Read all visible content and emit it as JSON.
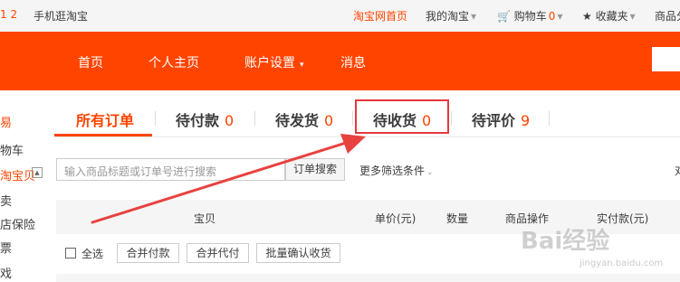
{
  "topbar": {
    "badge": "1 2",
    "mobile_link": "手机逛淘宝",
    "home_link": "淘宝网首页",
    "my_taobao": "我的淘宝",
    "cart_label": "购物车",
    "cart_count": "0",
    "favorites": "收藏夹",
    "goods_category": "商品分"
  },
  "nav": {
    "home": "首页",
    "profile": "个人主页",
    "account_settings": "账户设置",
    "messages": "消息"
  },
  "sidebar": {
    "items": [
      "易",
      "物车",
      "淘宝贝",
      "卖",
      "店保险",
      "票",
      "戏"
    ]
  },
  "tabs": [
    {
      "label": "所有订单",
      "count": ""
    },
    {
      "label": "待付款",
      "count": "0"
    },
    {
      "label": "待发货",
      "count": "0"
    },
    {
      "label": "待收货",
      "count": "0"
    },
    {
      "label": "待评价",
      "count": "9"
    }
  ],
  "search": {
    "placeholder": "输入商品标题或订单号进行搜索",
    "button": "订单搜索",
    "more_filters": "更多筛选条件",
    "edge_char": "对"
  },
  "table_headers": [
    "宝贝",
    "单价(元)",
    "数量",
    "商品操作",
    "实付款(元)"
  ],
  "batch_actions": {
    "select_all": "全选",
    "merge_pay": "合并付款",
    "merge_proxy_pay": "合并代付",
    "batch_confirm": "批量确认收货"
  },
  "watermark": {
    "text": "Bai经验",
    "sub": "jingyan.baidu.com"
  },
  "colors": {
    "brand": "#ff4400",
    "highlight": "#e4393c"
  }
}
